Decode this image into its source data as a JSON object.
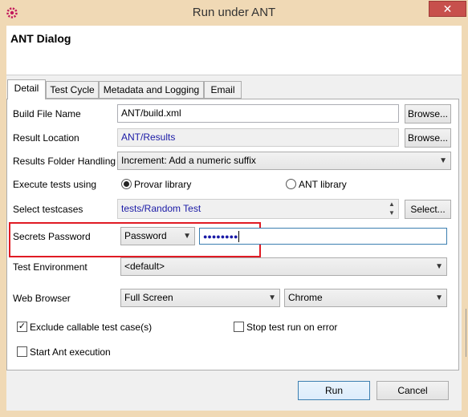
{
  "window": {
    "title": "Run under ANT",
    "close_glyph": "✕"
  },
  "dialog": {
    "title": "ANT Dialog"
  },
  "tabs": [
    "Detail",
    "Test Cycle",
    "Metadata and Logging",
    "Email"
  ],
  "build_file": {
    "label": "Build File Name",
    "value": "ANT/build.xml",
    "button": "Browse..."
  },
  "result_location": {
    "label": "Result Location",
    "value": "ANT/Results",
    "button": "Browse..."
  },
  "results_folder": {
    "label": "Results Folder Handling",
    "value": "Increment: Add a numeric suffix"
  },
  "execute": {
    "label": "Execute tests using",
    "option1": "Provar library",
    "option2": "ANT library",
    "selected": "Provar library"
  },
  "testcases": {
    "label": "Select testcases",
    "value": "tests/Random Test",
    "button": "Select..."
  },
  "secrets": {
    "label": "Secrets Password",
    "mode": "Password",
    "value": "●●●●●●●●"
  },
  "environment": {
    "label": "Test Environment",
    "value": "<default>"
  },
  "browser": {
    "label": "Web Browser",
    "size": "Full Screen",
    "name": "Chrome"
  },
  "checks": {
    "exclude_callable": {
      "label": "Exclude callable test case(s)",
      "checked": true
    },
    "stop_on_error": {
      "label": "Stop test run on error",
      "checked": false
    },
    "start_ant": {
      "label": "Start Ant execution",
      "checked": false
    }
  },
  "footer": {
    "run": "Run",
    "cancel": "Cancel"
  },
  "icons": {
    "app": "gear-icon",
    "dropdown": "chevron-down-icon",
    "check": "✓"
  },
  "colors": {
    "titlebar": "#f0d9b5",
    "close": "#c7504c",
    "highlight": "#e01b24",
    "link_text": "#1a1aa6"
  }
}
